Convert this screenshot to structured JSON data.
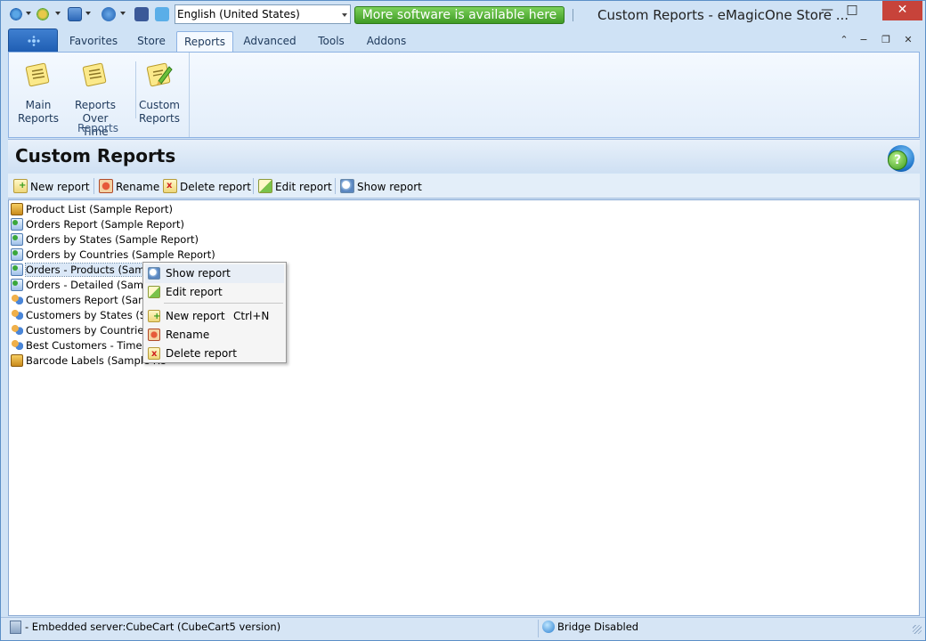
{
  "app": {
    "window_title": "Custom Reports - eMagicOne Store ...",
    "language": "English (United States)",
    "promo": "More software is available here"
  },
  "ribbon": {
    "tabs": [
      "Favorites",
      "Store",
      "Reports",
      "Advanced",
      "Tools",
      "Addons"
    ],
    "active_tab": "Reports",
    "buttons": [
      {
        "line1": "Main",
        "line2": "Reports"
      },
      {
        "line1": "Reports",
        "line2": "Over Time"
      },
      {
        "line1": "Custom",
        "line2": "Reports"
      }
    ],
    "group_label": "Reports"
  },
  "header": {
    "title": "Custom Reports"
  },
  "toolbar": {
    "new_report": "New report",
    "rename": "Rename",
    "delete_report": "Delete report",
    "edit_report": "Edit report",
    "show_report": "Show report"
  },
  "reports": [
    {
      "label": "Product List (Sample Report)",
      "icon": "package-icon"
    },
    {
      "label": "Orders Report (Sample Report)",
      "icon": "order-icon"
    },
    {
      "label": "Orders by States (Sample Report)",
      "icon": "order-icon"
    },
    {
      "label": "Orders by Countries (Sample Report)",
      "icon": "order-icon"
    },
    {
      "label": "Orders - Products (Sample R",
      "icon": "order-icon"
    },
    {
      "label": "Orders - Detailed (Sample R",
      "icon": "order-icon"
    },
    {
      "label": "Customers Report (Sample",
      "icon": "customers-icon"
    },
    {
      "label": "Customers by States (Samp",
      "icon": "customers-icon"
    },
    {
      "label": "Customers by Countries (Sa",
      "icon": "customers-icon"
    },
    {
      "label": "Best Customers - Timeline (",
      "icon": "customers-icon"
    },
    {
      "label": "Barcode Labels (Sample Re",
      "icon": "package-icon"
    }
  ],
  "context_menu": {
    "show_report": "Show report",
    "edit_report": "Edit report",
    "new_report": "New report",
    "new_report_shortcut": "Ctrl+N",
    "rename": "Rename",
    "delete_report": "Delete report"
  },
  "status": {
    "server": "- Embedded server:CubeCart (CubeCart5 version)",
    "bridge": "Bridge Disabled"
  }
}
